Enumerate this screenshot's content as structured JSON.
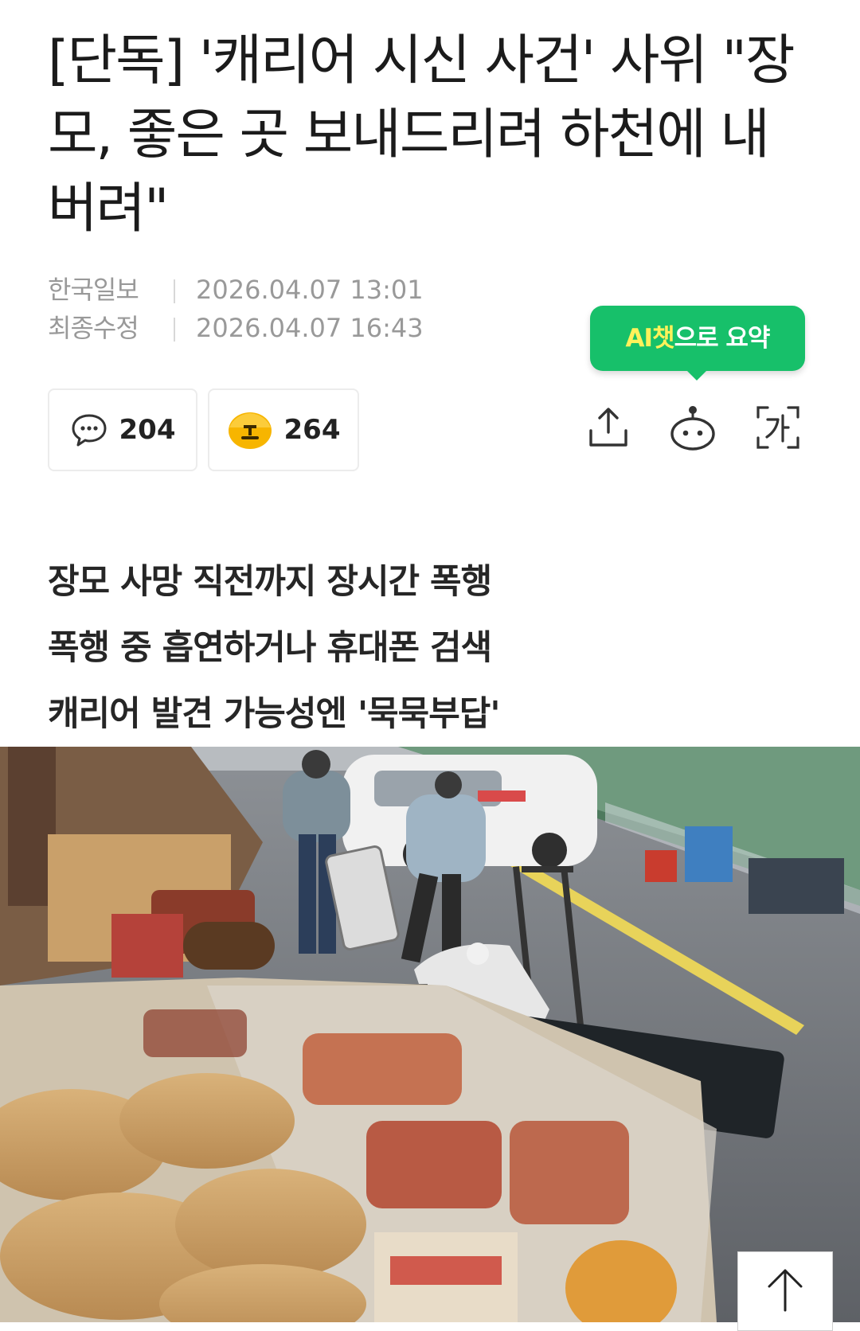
{
  "article": {
    "title": "[단독] '캐리어 시신 사건' 사위 \"장모, 좋은 곳 보내드리려 하천에 내버려\"",
    "publisher": "한국일보",
    "published_label": "",
    "published_at": "2026.04.07 13:01",
    "modified_label": "최종수정",
    "modified_at": "2026.04.07 16:43",
    "subheadings": [
      "장모 사망 직전까지 장시간 폭행",
      "폭행 중 흡연하거나 휴대폰 검색",
      "캐리어 발견 가능성엔 '묵묵부답'"
    ]
  },
  "ai_summary": {
    "highlight": "AI챗",
    "rest": "으로 요약"
  },
  "stats": {
    "comments": "204",
    "reactions": "264"
  },
  "icons": {
    "comments": "speech-bubble-icon",
    "reactions": "emoji-face-icon",
    "share": "share-icon",
    "ai_chat": "robot-icon",
    "font_size": "font-size-icon",
    "scroll_top": "arrow-up-icon"
  },
  "colors": {
    "accent": "#17c06a",
    "accent_highlight": "#fff25a"
  }
}
